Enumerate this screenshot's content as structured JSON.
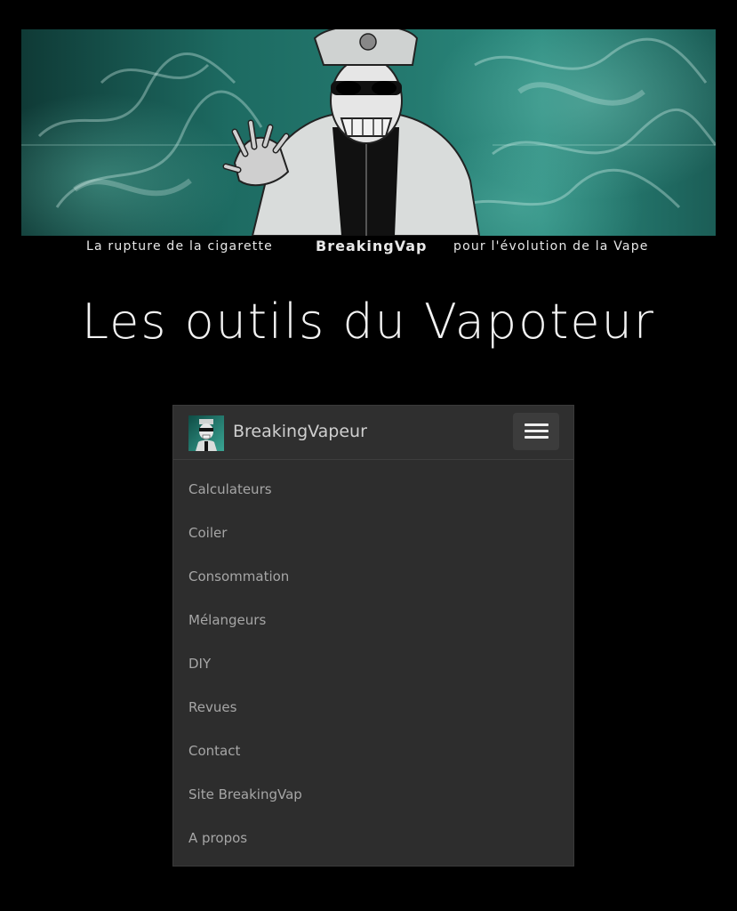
{
  "banner": {
    "tagline_left": "La rupture de la cigarette",
    "tagline_center": "BreakingVap",
    "tagline_right": "pour l'évolution de la Vape"
  },
  "page": {
    "title": "Les outils du Vapoteur"
  },
  "navbar": {
    "brand": "BreakingVapeur",
    "items": [
      {
        "label": "Calculateurs"
      },
      {
        "label": "Coiler"
      },
      {
        "label": "Consommation"
      },
      {
        "label": "Mélangeurs"
      },
      {
        "label": "DIY"
      },
      {
        "label": "Revues"
      },
      {
        "label": "Contact"
      },
      {
        "label": "Site BreakingVap"
      },
      {
        "label": "A propos"
      }
    ]
  },
  "colors": {
    "background": "#000000",
    "banner_teal": "#24796f",
    "card": "#2d2d2d",
    "menu_text": "#a6a6a6"
  },
  "icons": {
    "logo": "skull-mascot-icon",
    "menu": "hamburger-icon"
  }
}
